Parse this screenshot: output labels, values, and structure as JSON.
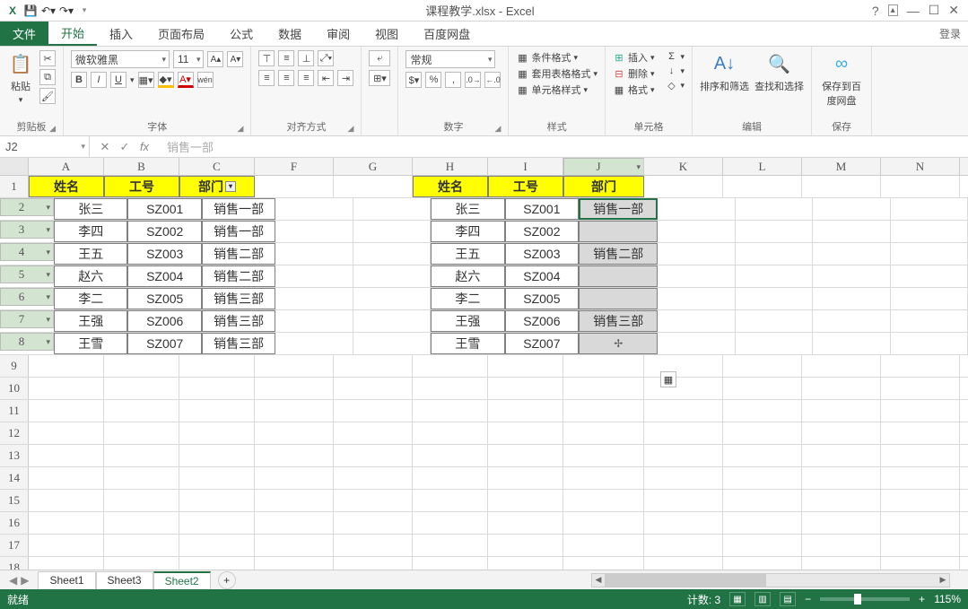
{
  "title": "课程教学.xlsx - Excel",
  "tabs": {
    "file": "文件",
    "home": "开始",
    "insert": "插入",
    "layout": "页面布局",
    "formula": "公式",
    "data": "数据",
    "review": "审阅",
    "view": "视图",
    "baidu": "百度网盘",
    "login": "登录"
  },
  "ribbon": {
    "clipboard": {
      "paste": "粘贴",
      "label": "剪贴板"
    },
    "font": {
      "name": "微软雅黑",
      "size": "11",
      "b": "B",
      "i": "I",
      "u": "U",
      "wen": "wén",
      "label": "字体"
    },
    "align": {
      "label": "对齐方式",
      "wrap": "自动换行"
    },
    "number": {
      "format": "常规",
      "label": "数字"
    },
    "styles": {
      "cond": "条件格式",
      "tbl": "套用表格格式",
      "cell": "单元格样式",
      "label": "样式"
    },
    "cells": {
      "ins": "插入",
      "del": "删除",
      "fmt": "格式",
      "label": "单元格"
    },
    "edit": {
      "sortf": "排序和筛选",
      "find": "查找和选择",
      "label": "编辑"
    },
    "save": {
      "baidu": "保存到百度网盘",
      "label": "保存"
    }
  },
  "fbar": {
    "name": "J2",
    "fx": "fx",
    "formula": "销售一部"
  },
  "cols": [
    "A",
    "B",
    "C",
    "F",
    "G",
    "H",
    "I",
    "J",
    "K",
    "L",
    "M",
    "N"
  ],
  "colSel": "J",
  "rows": 18,
  "table1": {
    "headers": [
      "姓名",
      "工号",
      "部门"
    ],
    "data": [
      [
        "张三",
        "SZ001",
        "销售一部"
      ],
      [
        "李四",
        "SZ002",
        "销售一部"
      ],
      [
        "王五",
        "SZ003",
        "销售二部"
      ],
      [
        "赵六",
        "SZ004",
        "销售二部"
      ],
      [
        "李二",
        "SZ005",
        "销售三部"
      ],
      [
        "王强",
        "SZ006",
        "销售三部"
      ],
      [
        "王雪",
        "SZ007",
        "销售三部"
      ]
    ]
  },
  "table2": {
    "headers": [
      "姓名",
      "工号",
      "部门"
    ],
    "data": [
      [
        "张三",
        "SZ001",
        "销售一部"
      ],
      [
        "李四",
        "SZ002",
        ""
      ],
      [
        "王五",
        "SZ003",
        "销售二部"
      ],
      [
        "赵六",
        "SZ004",
        ""
      ],
      [
        "李二",
        "SZ005",
        ""
      ],
      [
        "王强",
        "SZ006",
        "销售三部"
      ],
      [
        "王雪",
        "SZ007",
        ""
      ]
    ],
    "selectedCol": 2,
    "handleRow": 7
  },
  "sheets": {
    "list": [
      "Sheet1",
      "Sheet3",
      "Sheet2"
    ],
    "active": "Sheet2"
  },
  "status": {
    "ready": "就绪",
    "count": "计数: 3",
    "zoom": "115%"
  }
}
